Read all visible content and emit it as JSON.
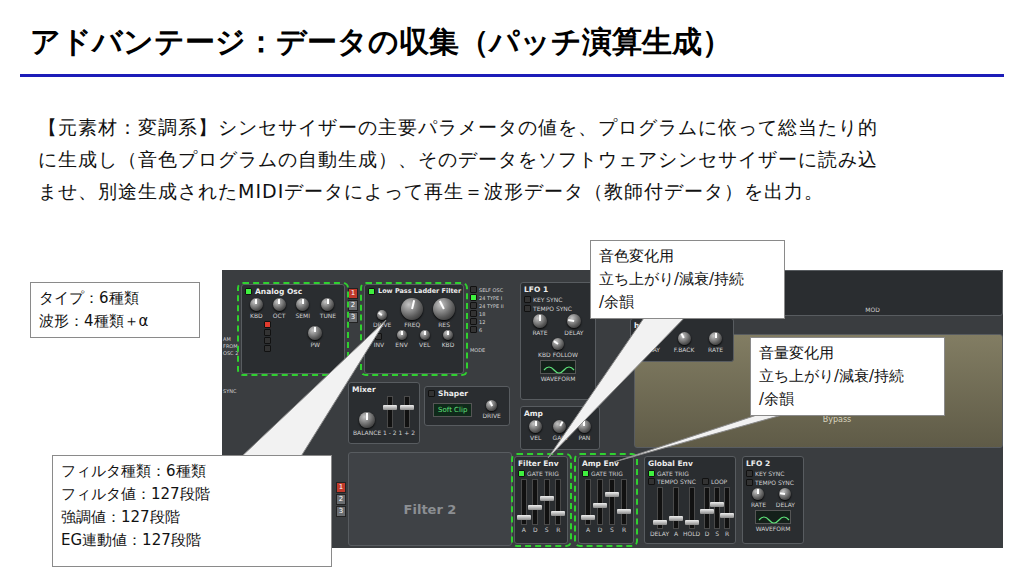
{
  "slide": {
    "title": "アドバンテージ：データの収集（パッチ演算生成）",
    "body": [
      "【元素材：変調系】シンセサイザーの主要パラメータの値を、プログラムに依って総当たり的",
      "に生成し（音色プログラムの自動生成）、そのデータをソフトウェアシンセサイザーに読み込",
      "ませ、別途生成されたMIDIデータによって再生＝波形データ（教師付データ）を出力。"
    ]
  },
  "synth": {
    "side": {
      "labels": [
        "AM",
        "FROM",
        "OSC 2"
      ],
      "sync": "SYNC"
    },
    "osc": {
      "title": "Analog Osc",
      "on": true,
      "knobs": [
        {
          "label": "KBD",
          "level": 0.5
        },
        {
          "label": "OCT",
          "level": 0.5
        },
        {
          "label": "SEMI",
          "level": 0.5
        },
        {
          "label": "TUNE",
          "level": 0.5
        }
      ],
      "waves": [
        {
          "selected": true
        },
        {
          "selected": false
        },
        {
          "selected": false
        },
        {
          "selected": false
        }
      ],
      "pw": {
        "label": "PW",
        "level": 0.5
      }
    },
    "slots_top": [
      {
        "label": "1",
        "selected": true
      },
      {
        "label": "2",
        "selected": false
      },
      {
        "label": "3",
        "selected": false
      }
    ],
    "filter": {
      "title": "Low Pass Ladder Filter",
      "on": true,
      "drive": {
        "label": "DRIVE",
        "level": 0.3
      },
      "main": [
        {
          "label": "FREQ",
          "level": 0.55
        },
        {
          "label": "RES",
          "level": 0.4
        }
      ],
      "inv": {
        "label": "INV",
        "on": false
      },
      "mods": [
        {
          "label": "ENV",
          "level": 0.5
        },
        {
          "label": "VEL",
          "level": 0.5
        },
        {
          "label": "KBD",
          "level": 0.5
        }
      ]
    },
    "modes": {
      "items": [
        {
          "label": "SELF OSC",
          "selected": false
        },
        {
          "label": "24 TYPE I",
          "selected": true
        },
        {
          "label": "24 TYPE II",
          "selected": false
        },
        {
          "label": "18",
          "selected": false
        },
        {
          "label": "12",
          "selected": false
        },
        {
          "label": "6",
          "selected": false
        }
      ],
      "label": "MODE"
    },
    "lfo1": {
      "title": "LFO 1",
      "options": [
        {
          "label": "KEY SYNC",
          "on": false
        },
        {
          "label": "TEMPO SYNC",
          "on": false
        }
      ],
      "knobs": [
        {
          "label": "RATE",
          "level": 0.5
        },
        {
          "label": "DELAY",
          "level": 0.2
        }
      ],
      "follow": {
        "label": "KBD FOLLOW",
        "level": 0.3
      },
      "waveform": "WAVEFORM"
    },
    "mixer": {
      "title": "Mixer",
      "balance": {
        "label": "BALANCE",
        "level": 0.5
      },
      "faders": [
        {
          "label": "1 - 2",
          "level": 0.7
        },
        {
          "label": "1 + 2",
          "level": 0.7
        }
      ]
    },
    "shaper": {
      "title": "Shaper",
      "on": false,
      "mode": "Soft Clip",
      "drive": {
        "label": "DRIVE",
        "level": 0.4
      }
    },
    "amp": {
      "title": "Amp",
      "knobs": [
        {
          "label": "VEL",
          "level": 0.5
        },
        {
          "label": "GAIN",
          "level": 0.6
        },
        {
          "label": "PAN",
          "level": 0.5
        }
      ]
    },
    "filter2": {
      "title": "Filter 2"
    },
    "slots_bottom": [
      {
        "label": "1",
        "selected": true
      },
      {
        "label": "2",
        "selected": false
      },
      {
        "label": "3",
        "selected": false
      }
    ],
    "filter_env": {
      "title": "Filter Env",
      "gate": {
        "label": "GATE TRIG",
        "on": true
      },
      "sliders": [
        {
          "label": "A",
          "level": 0.1
        },
        {
          "label": "D",
          "level": 0.35
        },
        {
          "label": "S",
          "level": 0.6
        },
        {
          "label": "R",
          "level": 0.2
        }
      ]
    },
    "amp_env": {
      "title": "Amp Env",
      "gate": {
        "label": "GATE TRIG",
        "on": true
      },
      "sliders": [
        {
          "label": "A",
          "level": 0.1
        },
        {
          "label": "D",
          "level": 0.4
        },
        {
          "label": "S",
          "level": 0.7
        },
        {
          "label": "R",
          "level": 0.25
        }
      ]
    },
    "global_env": {
      "title": "Global Env",
      "options": [
        {
          "label": "GATE TRIG",
          "on": true
        },
        {
          "label": "TEMPO SYNC",
          "on": false
        },
        {
          "label": "LOOP",
          "on": false
        }
      ],
      "sliders": [
        {
          "label": "DELAY",
          "level": 0.1
        },
        {
          "label": "A",
          "level": 0.2
        },
        {
          "label": "HOLD",
          "level": 0.1
        },
        {
          "label": "D",
          "level": 0.4
        },
        {
          "label": "S",
          "level": 0.6
        },
        {
          "label": "R",
          "level": 0.3
        }
      ]
    },
    "lfo2": {
      "title": "LFO 2",
      "options": [
        {
          "label": "KEY SYNC",
          "on": false
        },
        {
          "label": "TEMPO SYNC",
          "on": false
        }
      ],
      "knobs": [
        {
          "label": "RATE",
          "level": 0.5
        },
        {
          "label": "DELAY",
          "level": 0.2
        }
      ],
      "waveform": "WAVEFORM"
    },
    "chorus": {
      "title": "horus",
      "knobs": [
        {
          "label": "DELAY",
          "level": 0.5
        },
        {
          "label": "F.BACK",
          "level": 0.4
        },
        {
          "label": "RATE",
          "level": 0.5
        }
      ]
    },
    "filter3": {
      "title": "Filter 3",
      "state": "Bypass"
    },
    "top_right": {
      "label": "MOD"
    }
  },
  "callouts": [
    {
      "lines": [
        "タイプ：6種類",
        "波形：4種類＋α"
      ]
    },
    {
      "lines": [
        "フィルタ種類：6種類",
        "フィルタ値：127段階",
        "強調値：127段階",
        "EG連動値：127段階"
      ]
    },
    {
      "lines": [
        "音色変化用",
        "立ち上がり/減衰/持続",
        "/余韻"
      ]
    },
    {
      "lines": [
        "音量変化用",
        "立ち上がり/減衰/持続",
        "/余韻"
      ]
    }
  ]
}
